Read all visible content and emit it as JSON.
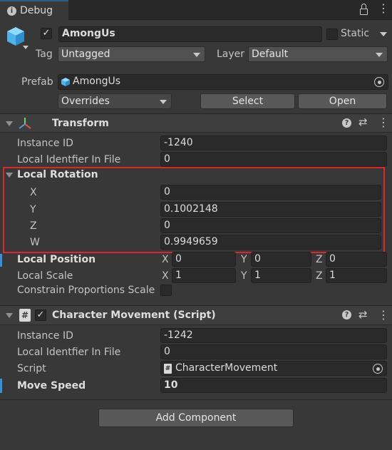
{
  "tab": {
    "title": "Debug"
  },
  "gameobject": {
    "name": "AmongUs",
    "static_label": "Static",
    "tag_label": "Tag",
    "tag_value": "Untagged",
    "layer_label": "Layer",
    "layer_value": "Default",
    "active": true,
    "static": false
  },
  "prefab": {
    "label": "Prefab",
    "value": "AmongUs",
    "overrides": "Overrides",
    "select": "Select",
    "open": "Open"
  },
  "transform": {
    "title": "Transform",
    "instance_id_label": "Instance ID",
    "instance_id": "-1240",
    "local_id_label": "Local Identfier In File",
    "local_id": "0",
    "rotation_label": "Local Rotation",
    "rot": [
      {
        "axis": "X",
        "value": "0"
      },
      {
        "axis": "Y",
        "value": "0.1002148"
      },
      {
        "axis": "Z",
        "value": "0"
      },
      {
        "axis": "W",
        "value": "0.9949659"
      }
    ],
    "position_label": "Local Position",
    "position": {
      "x": "0",
      "y": "0",
      "z": "0"
    },
    "scale_label": "Local Scale",
    "scale": {
      "x": "1",
      "y": "1",
      "z": "1"
    },
    "constrain_label": "Constrain Proportions Scale",
    "constrain": false
  },
  "axis_letters": {
    "x": "X",
    "y": "Y",
    "z": "Z"
  },
  "character": {
    "title": "Character Movement (Script)",
    "enabled": true,
    "instance_id_label": "Instance ID",
    "instance_id": "-1242",
    "local_id_label": "Local Identfier In File",
    "local_id": "0",
    "script_label": "Script",
    "script_value": "CharacterMovement",
    "speed_label": "Move Speed",
    "speed_value": "10"
  },
  "add_component": "Add Component",
  "colors": {
    "highlight": "#e0262b",
    "accent": "#3b8fd9"
  }
}
